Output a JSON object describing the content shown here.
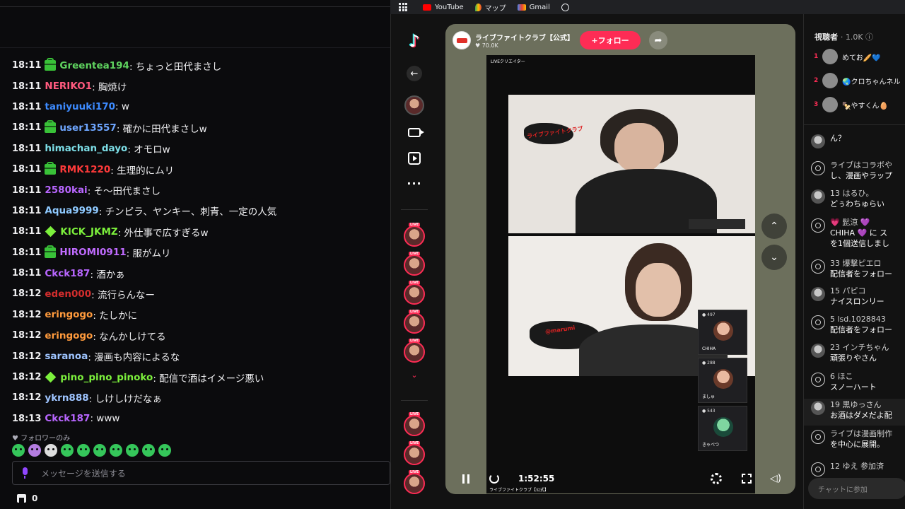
{
  "chat": {
    "messages": [
      {
        "time": "18:11",
        "badge": "gift",
        "user": "Greentea194",
        "color": "#5fd35f",
        "text": ": ちょっと田代まさし"
      },
      {
        "time": "18:11",
        "badge": "",
        "user": "NERIKO1",
        "color": "#ff5a7e",
        "text": ": 胸焼け"
      },
      {
        "time": "18:11",
        "badge": "",
        "user": "taniyuuki170",
        "color": "#3d8bff",
        "text": ": w"
      },
      {
        "time": "18:11",
        "badge": "gift",
        "user": "user13557",
        "color": "#6ea6ff",
        "text": ": 確かに田代まさしw"
      },
      {
        "time": "18:11",
        "badge": "",
        "user": "himachan_dayo",
        "color": "#7ddfe8",
        "text": ": オモロw"
      },
      {
        "time": "18:11",
        "badge": "gift",
        "user": "RMK1220",
        "color": "#ff3a3a",
        "text": ": 生理的にムリ"
      },
      {
        "time": "18:11",
        "badge": "",
        "user": "2580kai",
        "color": "#b866ff",
        "text": ": そ〜田代まさし"
      },
      {
        "time": "18:11",
        "badge": "",
        "user": "Aqua9999",
        "color": "#8ec9ff",
        "text": ": チンピラ、ヤンキー、刺青、一定の人気"
      },
      {
        "time": "18:11",
        "badge": "diamond",
        "user": "KICK_JKMZ",
        "color": "#7cf03c",
        "text": ": 外仕事で広すぎるw"
      },
      {
        "time": "18:11",
        "badge": "gift",
        "user": "HIROMI0911",
        "color": "#c06bff",
        "text": ": 服がムリ"
      },
      {
        "time": "18:11",
        "badge": "",
        "user": "Ckck187",
        "color": "#b866ff",
        "text": ": 酒かぁ"
      },
      {
        "time": "18:12",
        "badge": "",
        "user": "eden000",
        "color": "#d22d2d",
        "text": ": 流行らんなー"
      },
      {
        "time": "18:12",
        "badge": "",
        "user": "eringogo",
        "color": "#ff9a3c",
        "text": ": たしかに"
      },
      {
        "time": "18:12",
        "badge": "",
        "user": "eringogo",
        "color": "#ff9a3c",
        "text": ": なんかしけてる"
      },
      {
        "time": "18:12",
        "badge": "",
        "user": "saranoa",
        "color": "#9ec4ff",
        "text": ": 漫画も内容によるな"
      },
      {
        "time": "18:12",
        "badge": "diamond",
        "user": "pino_pino_pinoko",
        "color": "#7cf03c",
        "text": ": 配信で酒はイメージ悪い"
      },
      {
        "time": "18:12",
        "badge": "",
        "user": "ykrn888",
        "color": "#9ec4ff",
        "text": ": しけしけだなぁ"
      },
      {
        "time": "18:13",
        "badge": "",
        "user": "Ckck187",
        "color": "#b866ff",
        "text": ": www"
      }
    ],
    "follower_only": "♥ フォロワーのみ",
    "input_placeholder": "メッセージを送信する",
    "store_count": "0",
    "emotes": [
      "green",
      "purple",
      "white",
      "green",
      "green",
      "green",
      "green",
      "green",
      "green",
      "green"
    ]
  },
  "browser": {
    "bookmarks": [
      "YouTube",
      "マップ",
      "Gmail"
    ]
  },
  "tiktok": {
    "logo": "♪",
    "host_name": "ライブファイトクラブ【公式】",
    "host_likes": "♥ 70.0K",
    "follow_label": "+フォロー",
    "share_label": "➦",
    "live_creator": "LIVEクリエイター",
    "guests": [
      {
        "count": "● 497",
        "name": "CHIHA"
      },
      {
        "count": "● 288",
        "name": "ましゅ"
      },
      {
        "count": "● 543",
        "name": "きゃべつ"
      }
    ],
    "time": "1:52:55",
    "caption": "ライブファイトクラブ【公式】",
    "splash_top": "ライブファイトクラブ",
    "splash_bottom": "@marumi"
  },
  "right": {
    "viewers_label": "視聴者",
    "viewers_count": "· 1.0K ⓘ",
    "ranking": [
      {
        "num": "1",
        "name": "めてお🥖💙"
      },
      {
        "num": "2",
        "name": "🌏クロちゃんネル"
      },
      {
        "num": "3",
        "name": "🍢やすくん🥚"
      }
    ],
    "comments": [
      {
        "icon": "photo",
        "l1": "",
        "l2": "ん？"
      },
      {
        "icon": "sys",
        "l1": "ライブはコラボや",
        "l2": "し、漫画やラップ"
      },
      {
        "icon": "photo",
        "l1": "13 はるひ。",
        "l2": "どぅわちゅらい",
        "lvl": "13"
      },
      {
        "icon": "sys",
        "l1": "💗 髭涼 💜 ",
        "l2": "CHIHA 💜 に ス",
        "l3": "を1個送信しまし"
      },
      {
        "icon": "sys",
        "l1": "33 爆撃ピエロ",
        "l2": "配信者をフォロー",
        "lvl": "33"
      },
      {
        "icon": "photo",
        "l1": "15 パピコ",
        "l2": "ナイスロンリー",
        "lvl": "15"
      },
      {
        "icon": "sys",
        "l1": "5 lsd.1028843",
        "l2": "配信者をフォロー",
        "lvl": "5"
      },
      {
        "icon": "photo",
        "l1": "23 インチちゃん",
        "l2": "頑張りやさん",
        "lvl": "23"
      },
      {
        "icon": "sys",
        "l1": "6 ほこ",
        "l2": "スノーハート",
        "lvl": "6"
      },
      {
        "icon": "photo",
        "l1": "19 黒ゆっさん",
        "l2": "お酒はダメだよ配",
        "lvl": "19"
      },
      {
        "icon": "sys",
        "l1": "ライブは漫画制作",
        "l2": "を中心に展開。"
      },
      {
        "icon": "sys",
        "l1": "12 ゆえ 参加済",
        "l2": "",
        "lvl": "12"
      }
    ],
    "chat_join_placeholder": "チャットに参加"
  }
}
